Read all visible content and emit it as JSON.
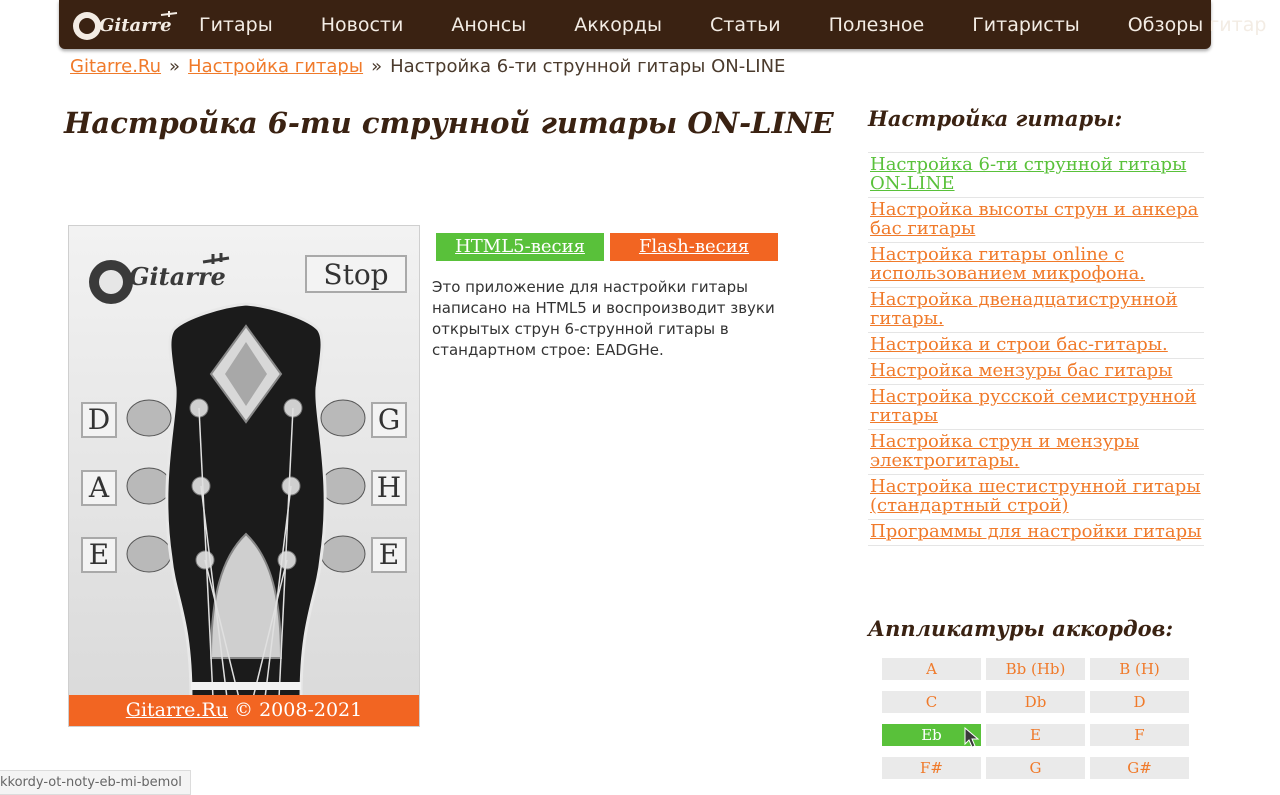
{
  "nav": {
    "logo_text": "Gitarre",
    "items": [
      "Гитары",
      "Новости",
      "Анонсы",
      "Аккорды",
      "Статьи",
      "Полезное",
      "Гитаристы",
      "Обзоры гитар"
    ]
  },
  "breadcrumb": {
    "home": "Gitarre.Ru",
    "section": "Настройка гитары",
    "current": "Настройка 6-ти струнной гитары ON-LINE",
    "separator": "»"
  },
  "page_title": "Настройка 6-ти струнной гитары ON-LINE",
  "tuner": {
    "logo_text": "Gitarre",
    "stop_label": "Stop",
    "strings_left": [
      "D",
      "A",
      "E"
    ],
    "strings_right": [
      "G",
      "H",
      "E"
    ],
    "footer_link": "Gitarre.Ru",
    "footer_text": "© 2008-2021"
  },
  "versions": {
    "html5_label": "HTML5-весия",
    "flash_label": "Flash-весия",
    "html5_color": "#59c13a",
    "flash_color": "#f26522"
  },
  "description": "Это приложение для настройки гитары написано на HTML5 и воспроизводит звуки открытых струн 6-струнной гитары в стандартном строе: EADGHe.",
  "sidebar": {
    "tuning_title": "Настройка гитары:",
    "tuning_links": [
      "Настройка 6-ти струнной гитары ON-LINE",
      "Настройка высоты струн и анкера бас гитары",
      "Настройка гитары online с использованием микрофона.",
      "Настройка двенадцатиструнной гитары.",
      "Настройка и строи бас-гитары.",
      "Настройка мензуры бас гитары",
      "Настройка русской семиструнной гитары",
      "Настройка струн и мензуры электрогитары.",
      "Настройка шестиструнной гитары (стандартный строй)",
      "Программы для настройки гитары"
    ],
    "active_link_index": 0,
    "chords_title": "Аппликатуры аккордов:",
    "chords": [
      "A",
      "Bb (Hb)",
      "B (H)",
      "C",
      "Db",
      "D",
      "Eb",
      "E",
      "F",
      "F#",
      "G",
      "G#"
    ],
    "active_chord": "Eb"
  },
  "status_bar": {
    "url": "kkordy-ot-noty-eb-mi-bemol"
  },
  "colors": {
    "nav_bg": "#3a2212",
    "accent_orange": "#f26522",
    "link_orange": "#f07a2a",
    "accent_green": "#59c13a"
  }
}
